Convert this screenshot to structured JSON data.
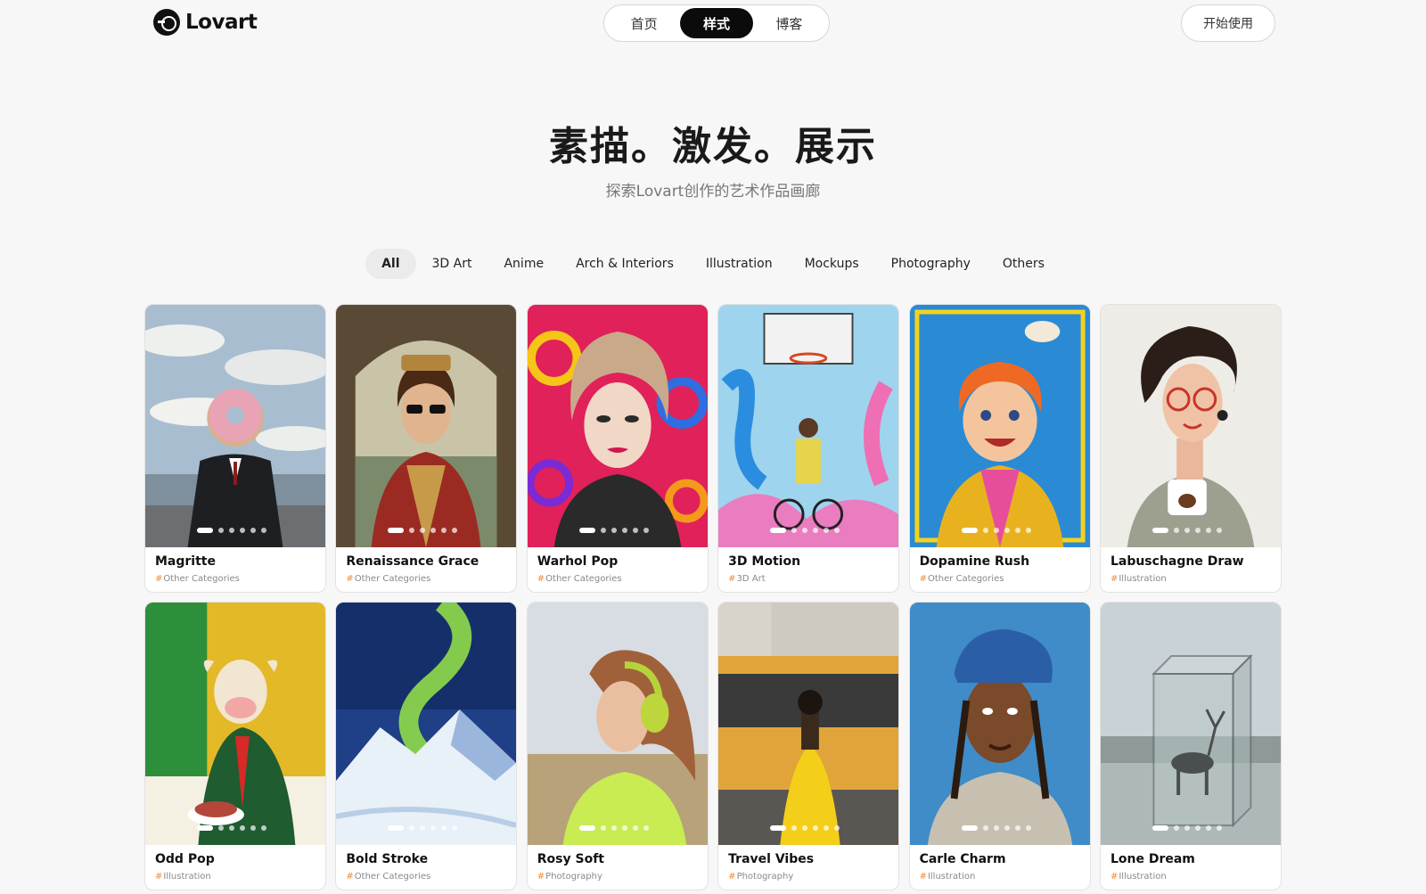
{
  "header": {
    "logo_text": "Lovart",
    "nav": [
      {
        "label": "首页",
        "active": false
      },
      {
        "label": "样式",
        "active": true
      },
      {
        "label": "博客",
        "active": false
      }
    ],
    "cta_label": "开始使用"
  },
  "hero": {
    "title": "素描。激发。展示",
    "subtitle": "探索Lovart创作的艺术作品画廊"
  },
  "filters": [
    "All",
    "3D Art",
    "Anime",
    "Arch & Interiors",
    "Illustration",
    "Mockups",
    "Photography",
    "Others"
  ],
  "active_filter": "All",
  "cards": [
    {
      "title": "Magritte",
      "category": "Other Categories",
      "image": "man-with-donut-face-painting"
    },
    {
      "title": "Renaissance Grace",
      "category": "Other Categories",
      "image": "renaissance-portrait-with-sunglasses"
    },
    {
      "title": "Warhol Pop",
      "category": "Other Categories",
      "image": "pop-art-woman-portrait"
    },
    {
      "title": "3D Motion",
      "category": "3D Art",
      "image": "cyclist-under-basketball-hoop"
    },
    {
      "title": "Dopamine Rush",
      "category": "Other Categories",
      "image": "colorful-boy-illustration-with-owl"
    },
    {
      "title": "Labuschagne Draw",
      "category": "Illustration",
      "image": "woman-with-coffee-cup-illustration"
    },
    {
      "title": "Odd Pop",
      "category": "Illustration",
      "image": "cow-in-suit-eating-cake"
    },
    {
      "title": "Bold Stroke",
      "category": "Other Categories",
      "image": "aurora-over-snowy-mountains"
    },
    {
      "title": "Rosy Soft",
      "category": "Photography",
      "image": "woman-with-headphones-photo"
    },
    {
      "title": "Travel Vibes",
      "category": "Photography",
      "image": "woman-in-yellow-dress-by-tram"
    },
    {
      "title": "Carle Charm",
      "category": "Illustration",
      "image": "man-with-cap-collage-portrait"
    },
    {
      "title": "Lone Dream",
      "category": "Illustration",
      "image": "deer-in-glass-box"
    }
  ],
  "colors": {
    "background": "#f7f7f7",
    "active_nav": "#0b0b0b",
    "tag_hash": "#f08c3a"
  }
}
